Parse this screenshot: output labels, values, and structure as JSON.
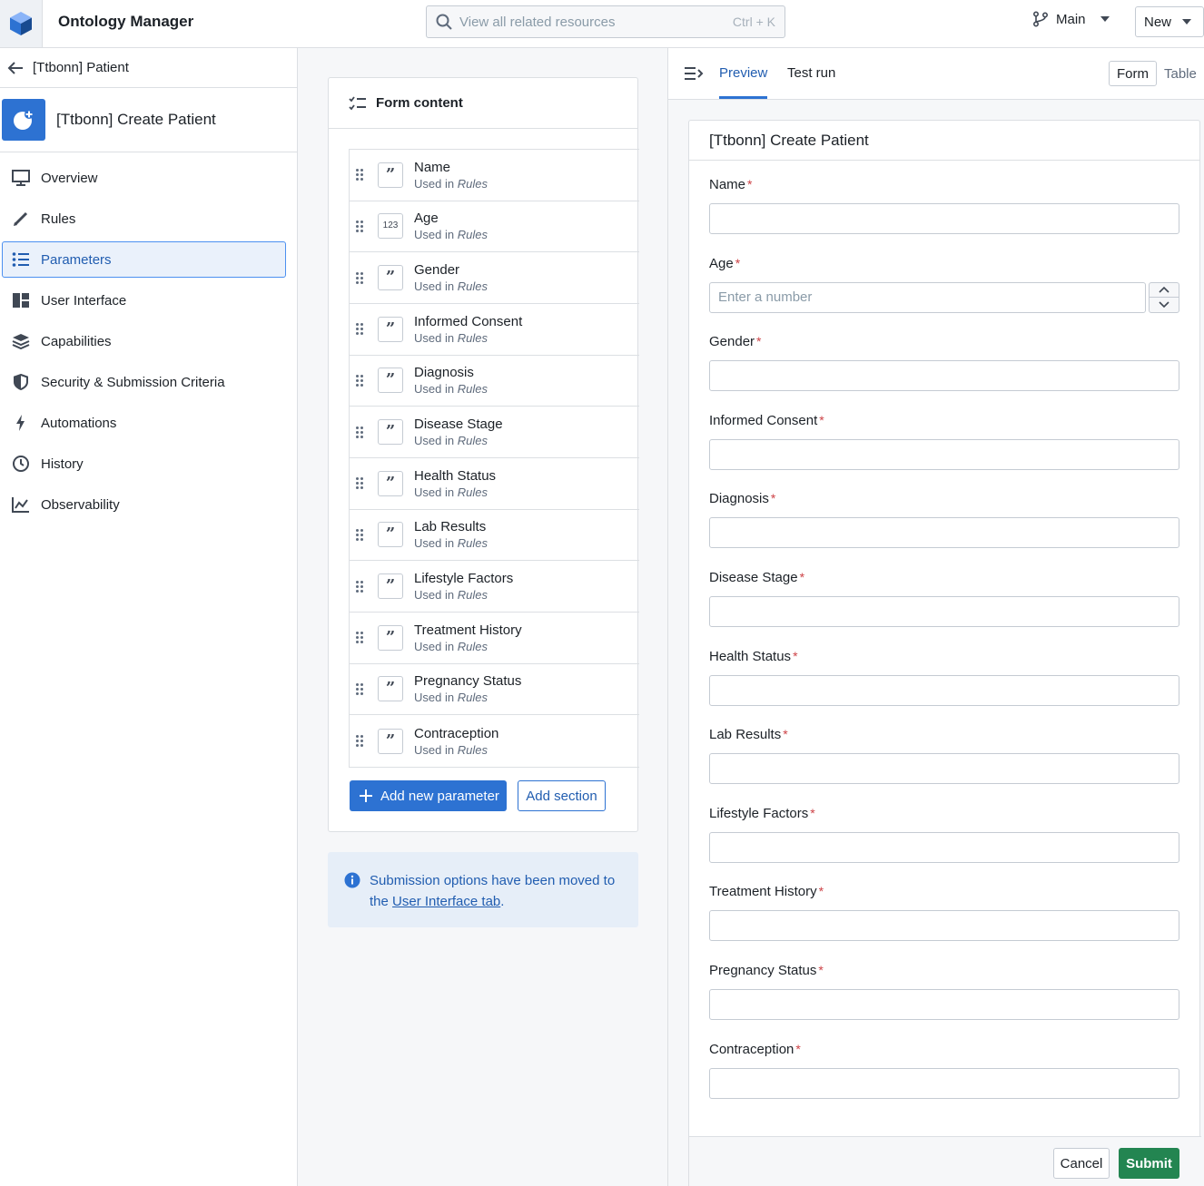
{
  "header": {
    "app_title": "Ontology Manager",
    "search_placeholder": "View all related resources",
    "search_shortcut": "Ctrl + K",
    "branch": "Main",
    "new_label": "New"
  },
  "sidebar": {
    "back_label": "[Ttbonn] Patient",
    "action_title": "[Ttbonn] Create Patient",
    "items": [
      {
        "label": "Overview",
        "icon": "monitor-icon"
      },
      {
        "label": "Rules",
        "icon": "pencil-icon"
      },
      {
        "label": "Parameters",
        "icon": "list-icon",
        "active": true
      },
      {
        "label": "User Interface",
        "icon": "layout-icon"
      },
      {
        "label": "Capabilities",
        "icon": "layers-icon"
      },
      {
        "label": "Security & Submission Criteria",
        "icon": "shield-icon"
      },
      {
        "label": "Automations",
        "icon": "lightning-icon"
      },
      {
        "label": "History",
        "icon": "clock-icon"
      },
      {
        "label": "Observability",
        "icon": "chart-icon"
      }
    ]
  },
  "form_content": {
    "title": "Form content",
    "used_in": "Used in",
    "used_in_target": "Rules",
    "params": [
      {
        "name": "Name",
        "type": "string"
      },
      {
        "name": "Age",
        "type": "number"
      },
      {
        "name": "Gender",
        "type": "string"
      },
      {
        "name": "Informed Consent",
        "type": "string"
      },
      {
        "name": "Diagnosis",
        "type": "string"
      },
      {
        "name": "Disease Stage",
        "type": "string"
      },
      {
        "name": "Health Status",
        "type": "string"
      },
      {
        "name": "Lab Results",
        "type": "string"
      },
      {
        "name": "Lifestyle Factors",
        "type": "string"
      },
      {
        "name": "Treatment History",
        "type": "string"
      },
      {
        "name": "Pregnancy Status",
        "type": "string"
      },
      {
        "name": "Contraception",
        "type": "string"
      }
    ],
    "number_badge": "123",
    "add_parameter": "Add new parameter",
    "add_section": "Add section"
  },
  "info": {
    "text_before": "Submission options have been moved to the ",
    "link": "User Interface tab",
    "text_after": "."
  },
  "preview": {
    "tabs": [
      "Preview",
      "Test run"
    ],
    "view_modes": [
      "Form",
      "Table"
    ],
    "form_title": "[Ttbonn] Create Patient",
    "required_mark": "*",
    "number_placeholder": "Enter a number",
    "fields": [
      "Name",
      "Age",
      "Gender",
      "Informed Consent",
      "Diagnosis",
      "Disease Stage",
      "Health Status",
      "Lab Results",
      "Lifestyle Factors",
      "Treatment History",
      "Pregnancy Status",
      "Contraception"
    ],
    "cancel": "Cancel",
    "submit": "Submit"
  }
}
